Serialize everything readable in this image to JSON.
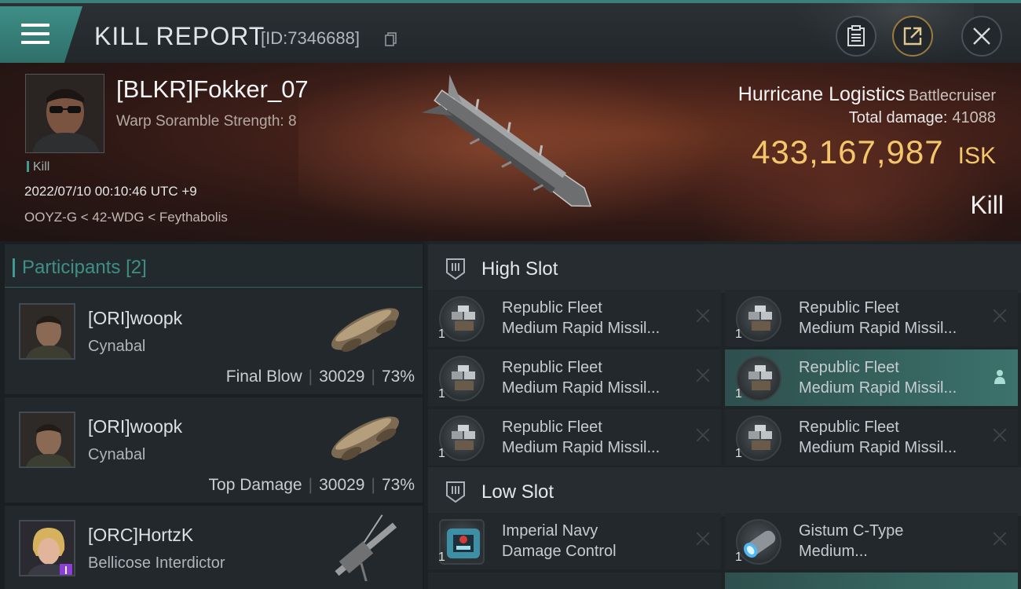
{
  "header": {
    "title": "KILL REPORT",
    "id_label": "[ID:7346688]",
    "icons": [
      "menu-icon",
      "copy-icon",
      "clipboard-icon",
      "share-icon",
      "close-icon"
    ]
  },
  "victim": {
    "name": "[BLKR]Fokker_07",
    "subtitle": "Warp Soramble Strength: 8",
    "kill_tag": "Kill",
    "datetime": "2022/07/10 00:10:46 UTC +9",
    "location": "OOYZ-G < 42-WDG < Feythabolis"
  },
  "ship": {
    "name": "Hurricane Logistics",
    "class": "Battlecruiser",
    "damage_label": "Total damage:",
    "damage_value": "41088",
    "isk_value": "433,167,987",
    "isk_unit": "ISK",
    "result": "Kill"
  },
  "participants": {
    "label": "Participants",
    "count": "[2]",
    "list": [
      {
        "name": "[ORI]woopk",
        "ship": "Cynabal",
        "role": "Final Blow",
        "damage": "30029",
        "percent": "73%"
      },
      {
        "name": "[ORI]woopk",
        "ship": "Cynabal",
        "role": "Top Damage",
        "damage": "30029",
        "percent": "73%"
      },
      {
        "name": "[ORC]HortzK",
        "ship": "Bellicose Interdictor",
        "role": "",
        "damage": "",
        "percent": ""
      }
    ]
  },
  "high_slot": {
    "label": "High Slot",
    "items": [
      {
        "line1": "Republic Fleet",
        "line2": "Medium Rapid Missil...",
        "qty": "1"
      },
      {
        "line1": "Republic Fleet",
        "line2": "Medium Rapid Missil...",
        "qty": "1"
      },
      {
        "line1": "Republic Fleet",
        "line2": "Medium Rapid Missil...",
        "qty": "1"
      },
      {
        "line1": "Republic Fleet",
        "line2": "Medium Rapid Missil...",
        "qty": "1"
      },
      {
        "line1": "Republic Fleet",
        "line2": "Medium Rapid Missil...",
        "qty": "1"
      },
      {
        "line1": "Republic Fleet",
        "line2": "Medium Rapid Missil...",
        "qty": "1"
      }
    ]
  },
  "low_slot": {
    "label": "Low Slot",
    "items": [
      {
        "line1": "Imperial Navy",
        "line2": "Damage Control",
        "qty": "1"
      },
      {
        "line1": "Gistum C-Type",
        "line2": "Medium...",
        "qty": "1"
      }
    ]
  },
  "colors": {
    "accent": "#3f9a8f",
    "isk": "#f5c76b",
    "active_item": "#3c726c"
  }
}
